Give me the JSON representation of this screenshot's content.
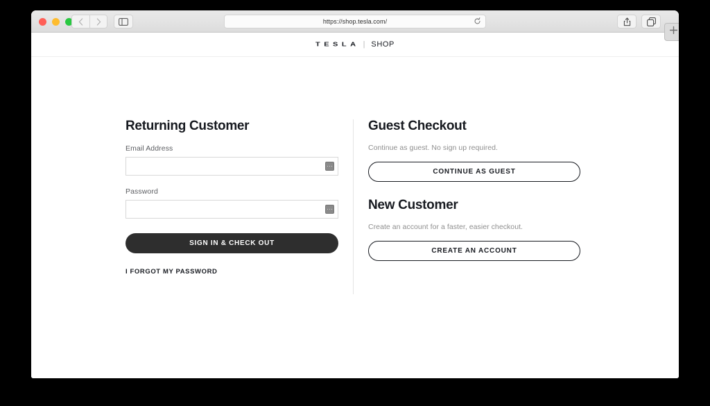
{
  "browser": {
    "url": "https://shop.tesla.com/",
    "traffic_lights": [
      "close-red",
      "minimize-yellow",
      "maximize-green"
    ],
    "back_icon": "chevron-left-icon",
    "forward_icon": "chevron-right-icon",
    "sidebar_icon": "sidebar-toggle-icon",
    "reload_icon": "reload-icon",
    "share_icon": "share-icon",
    "tabs_icon": "tabs-overview-icon",
    "new_tab_label": "+"
  },
  "site_header": {
    "brand": "TESLA",
    "separator": "|",
    "section": "SHOP"
  },
  "returning_customer": {
    "title": "Returning Customer",
    "email_label": "Email Address",
    "email_value": "",
    "email_placeholder": "",
    "password_label": "Password",
    "password_value": "",
    "password_placeholder": "",
    "autofill_icon": "autofill-contact-icon",
    "submit_label": "SIGN IN & CHECK OUT",
    "forgot_password_label": "I FORGOT MY PASSWORD"
  },
  "guest_checkout": {
    "title": "Guest Checkout",
    "description": "Continue as guest. No sign up required.",
    "button_label": "CONTINUE AS GUEST"
  },
  "new_customer": {
    "title": "New Customer",
    "description": "Create an account for a faster, easier checkout.",
    "button_label": "CREATE AN ACCOUNT"
  },
  "colors": {
    "brand_dark": "#171a20",
    "button_fill": "#2e2e2e",
    "muted_text": "#8e8e8e",
    "field_border": "#d8d8d8",
    "page_background": "#ffffff",
    "desktop_background": "#000000"
  }
}
